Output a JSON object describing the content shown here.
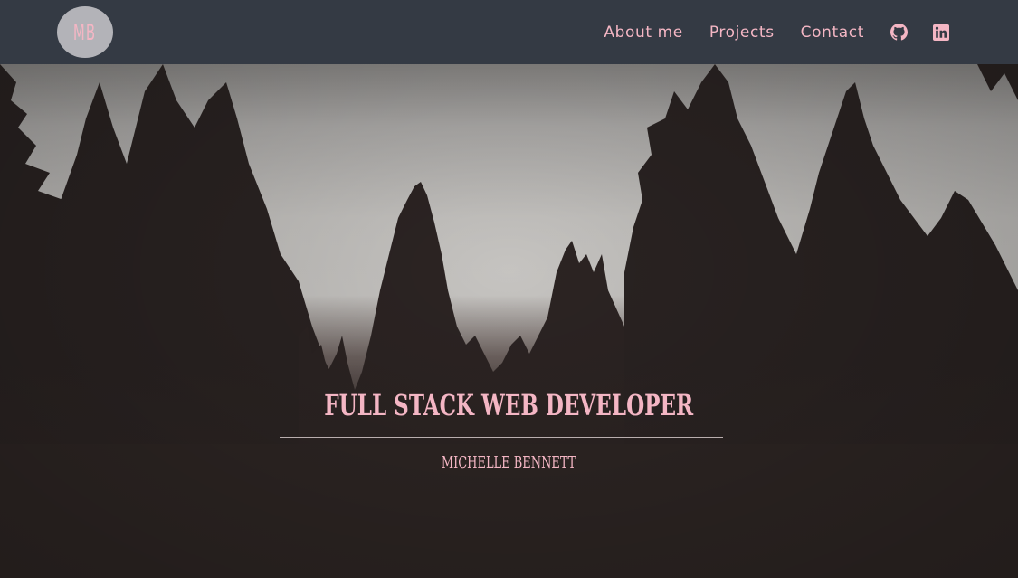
{
  "brand": {
    "logo_text": "MB"
  },
  "nav": {
    "links": [
      {
        "label": "About me"
      },
      {
        "label": "Projects"
      },
      {
        "label": "Contact"
      }
    ],
    "icons": [
      "github-icon",
      "linkedin-icon"
    ]
  },
  "hero": {
    "title": "FULL STACK WEB DEVELOPER",
    "subtitle": "MICHELLE BENNETT"
  },
  "colors": {
    "navbar_bg": "#343a44",
    "accent_pink": "#f4b6c4",
    "logo_bg": "#b3b3b8",
    "hero_dark": "#2e2726"
  }
}
